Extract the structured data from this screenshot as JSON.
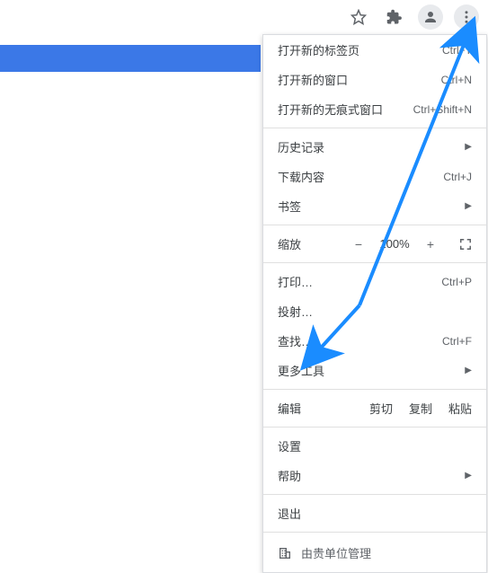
{
  "toolbar": {
    "bookmark_icon": "star",
    "extensions_icon": "puzzle",
    "profile_icon": "avatar",
    "menu_icon": "dots"
  },
  "menu": {
    "section1": {
      "new_tab": {
        "label": "打开新的标签页",
        "shortcut": "Ctrl+T"
      },
      "new_window": {
        "label": "打开新的窗口",
        "shortcut": "Ctrl+N"
      },
      "new_incognito": {
        "label": "打开新的无痕式窗口",
        "shortcut": "Ctrl+Shift+N"
      }
    },
    "section2": {
      "history": {
        "label": "历史记录"
      },
      "downloads": {
        "label": "下载内容",
        "shortcut": "Ctrl+J"
      },
      "bookmarks": {
        "label": "书签"
      }
    },
    "zoom": {
      "label": "缩放",
      "minus": "−",
      "value": "100%",
      "plus": "+"
    },
    "section3": {
      "print": {
        "label": "打印…",
        "shortcut": "Ctrl+P"
      },
      "cast": {
        "label": "投射…"
      },
      "find": {
        "label": "查找…",
        "shortcut": "Ctrl+F"
      },
      "more_tools": {
        "label": "更多工具"
      }
    },
    "edit": {
      "label": "编辑",
      "cut": "剪切",
      "copy": "复制",
      "paste": "粘贴"
    },
    "section4": {
      "settings": {
        "label": "设置"
      },
      "help": {
        "label": "帮助"
      }
    },
    "section5": {
      "exit": {
        "label": "退出"
      }
    },
    "managed": {
      "label": "由贵单位管理"
    }
  }
}
